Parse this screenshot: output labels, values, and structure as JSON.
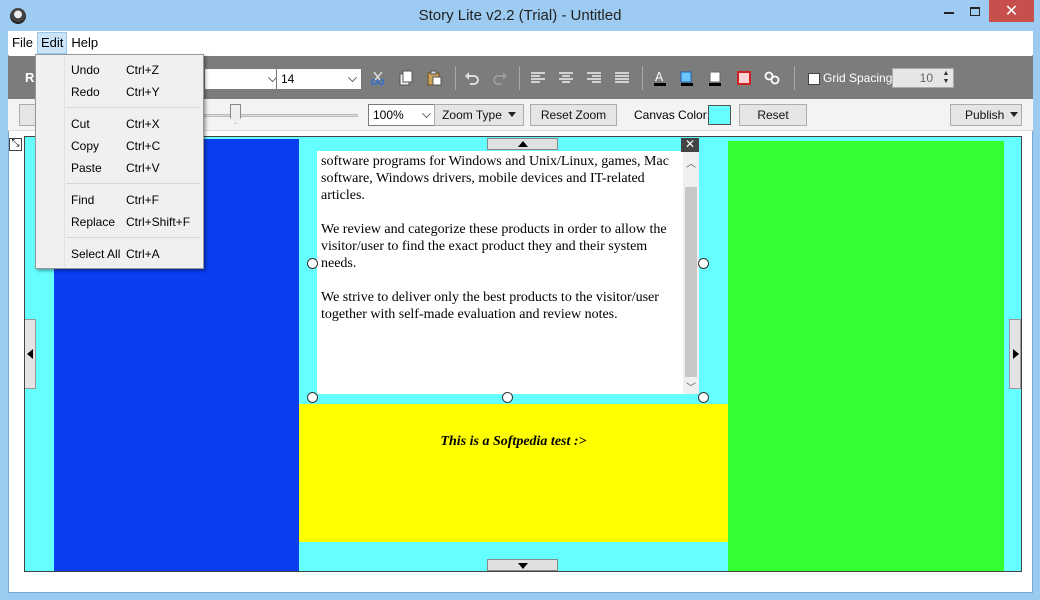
{
  "window": {
    "title": "Story Lite v2.2 (Trial) - Untitled",
    "minimize_icon": "minimize-icon",
    "maximize_icon": "maximize-icon",
    "close_glyph": "✕"
  },
  "menubar": {
    "file": "File",
    "edit": "Edit",
    "help": "Help"
  },
  "edit_menu": {
    "items": [
      {
        "label": "Undo",
        "shortcut": "Ctrl+Z"
      },
      {
        "label": "Redo",
        "shortcut": "Ctrl+Y"
      },
      {
        "label": "Cut",
        "shortcut": "Ctrl+X"
      },
      {
        "label": "Copy",
        "shortcut": "Ctrl+C"
      },
      {
        "label": "Paste",
        "shortcut": "Ctrl+V"
      },
      {
        "label": "Find",
        "shortcut": "Ctrl+F"
      },
      {
        "label": "Replace",
        "shortcut": "Ctrl+Shift+F"
      },
      {
        "label": "Select All",
        "shortcut": "Ctrl+A"
      }
    ]
  },
  "toolbar": {
    "style_letter": "R",
    "font_family": "",
    "font_size": "14",
    "grid_spacing_label": "Grid Spacing:",
    "grid_spacing_value": "10",
    "grid_checked": false,
    "icons": [
      "cut-icon",
      "copy-icon",
      "paste-icon",
      "undo-icon",
      "redo-icon",
      "align-left-icon",
      "align-center-icon",
      "align-right-icon",
      "justify-icon",
      "text-color-icon",
      "highlight-icon",
      "background-color-icon",
      "border-color-icon",
      "link-icon"
    ]
  },
  "toolbar2": {
    "zoom_value": "100%",
    "zoom_type": "Zoom Type",
    "reset_zoom": "Reset Zoom",
    "canvas_color_label": "Canvas Color:",
    "canvas_color": "#66ffff",
    "reset": "Reset",
    "publish": "Publish"
  },
  "canvas": {
    "background": "#66ffff",
    "panels": {
      "left_color": "#0a3cf0",
      "right_color": "#33ff33",
      "bottom_color": "#ffff00"
    },
    "text_box": {
      "paragraphs": [
        "software programs for Windows and Unix/Linux, games, Mac software, Windows drivers, mobile devices and IT-related articles.",
        "We review and categorize these products in order to allow the visitor/user to find the exact product they and their system needs.",
        "We strive to deliver only the best products to the visitor/user together with self-made evaluation and review notes."
      ]
    },
    "yellow_text": "This is a Softpedia test :>"
  }
}
